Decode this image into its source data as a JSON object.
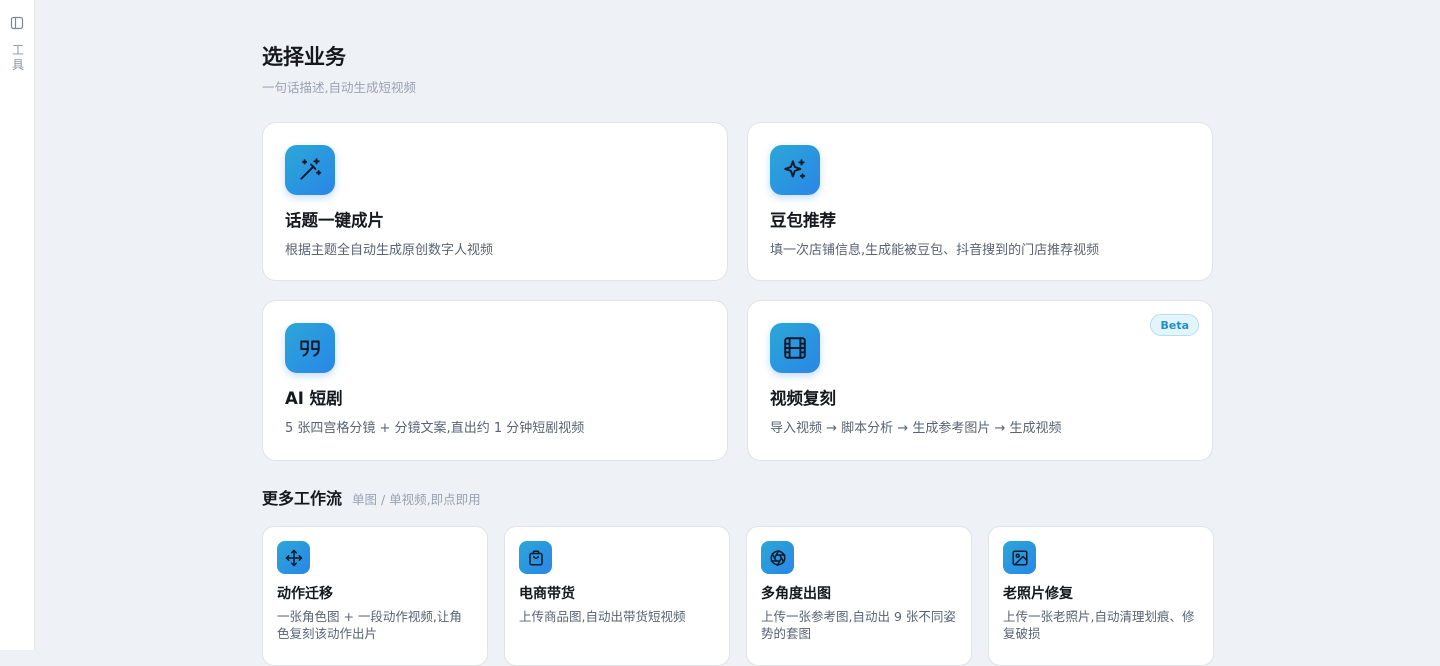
{
  "sidebar": {
    "label": "工具"
  },
  "header": {
    "title": "选择业务",
    "subtitle": "一句话描述,自动生成短视频"
  },
  "business_cards": [
    {
      "title": "话题一键成片",
      "description": "根据主题全自动生成原创数字人视频",
      "icon": "magic-wand-icon"
    },
    {
      "title": "豆包推荐",
      "description": "填一次店铺信息,生成能被豆包、抖音搜到的门店推荐视频",
      "icon": "sparkle-icon"
    },
    {
      "title": "AI 短剧",
      "description": "5 张四宫格分镜 + 分镜文案,直出约 1 分钟短剧视频",
      "icon": "quote-icon"
    },
    {
      "title": "视频复刻",
      "description": "导入视频 → 脚本分析 → 生成参考图片 → 生成视频",
      "icon": "film-icon",
      "badge": "Beta"
    }
  ],
  "workflows": {
    "title": "更多工作流",
    "hint": "单图 / 单视频,即点即用",
    "items": [
      {
        "title": "动作迁移",
        "description": "一张角色图 + 一段动作视频,让角色复刻该动作出片",
        "icon": "move-icon"
      },
      {
        "title": "电商带货",
        "description": "上传商品图,自动出带货短视频",
        "icon": "shopping-bag-icon"
      },
      {
        "title": "多角度出图",
        "description": "上传一张参考图,自动出 9 张不同姿势的套图",
        "icon": "aperture-icon"
      },
      {
        "title": "老照片修复",
        "description": "上传一张老照片,自动清理划痕、修复破损",
        "icon": "image-icon"
      }
    ]
  },
  "colors": {
    "background": "#eef1f6",
    "accent_gradient_start": "#2ba7d6",
    "accent_gradient_end": "#2a86e8",
    "beta_badge_text": "#1f90c6"
  }
}
